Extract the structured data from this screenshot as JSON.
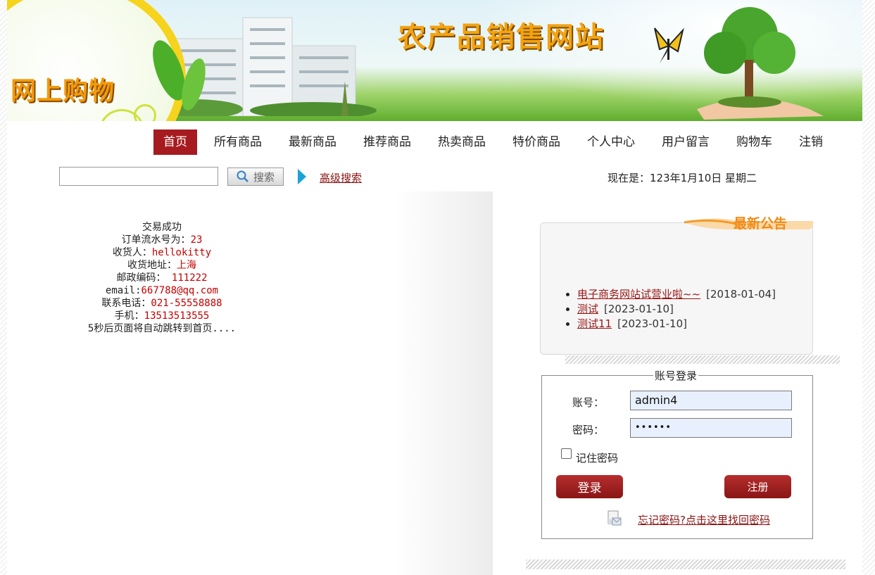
{
  "banner": {
    "logo_text": "网上购物",
    "site_title": "农产品销售网站"
  },
  "nav": {
    "items": [
      "首页",
      "所有商品",
      "最新商品",
      "推荐商品",
      "热卖商品",
      "特价商品",
      "个人中心",
      "用户留言",
      "购物车",
      "注销"
    ],
    "active": "首页"
  },
  "search": {
    "input_value": "",
    "button_label": "搜索",
    "advanced_link": "高级搜索"
  },
  "date_text": "现在是：123年1月10日 星期二",
  "receipt": {
    "title": "交易成功",
    "order_label": "订单流水号为：",
    "order_value": "23",
    "receiver_label": "收货人：",
    "receiver_value": "hellokitty",
    "address_label": "收货地址：",
    "address_value": "上海",
    "postcode_label": "邮政编码：",
    "postcode_value": "111222",
    "email_label": "email:",
    "email_value": "667788@qq.com",
    "phone_label": "联系电话：",
    "phone_value": "021-55558888",
    "mobile_label": "手机：",
    "mobile_value": "13513513555",
    "redirect_note": "5秒后页面将自动跳转到首页...."
  },
  "notice": {
    "header": "最新公告",
    "items": [
      {
        "title": "电子商务网站试营业啦~~",
        "date": "[2018-01-04]"
      },
      {
        "title": "测试",
        "date": "[2023-01-10]"
      },
      {
        "title": "测试11",
        "date": "[2023-01-10]"
      }
    ]
  },
  "login": {
    "legend": "账号登录",
    "account_label": "账号：",
    "account_value": "admin4",
    "password_label": "密码：",
    "password_value": "••••••",
    "remember_label": "记住密码",
    "remember_checked": false,
    "login_button": "登录",
    "register_button": "注册",
    "forgot_link": "忘记密码?点击这里找回密码"
  },
  "colors": {
    "nav_active": "#a61b1f",
    "link_red": "#8b1010",
    "value_red": "#c40000",
    "title_orange": "#f3a311"
  }
}
